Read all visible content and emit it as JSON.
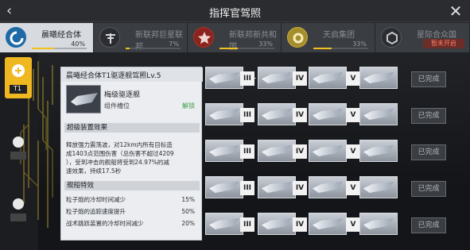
{
  "header": {
    "title": "指挥官驾照",
    "back_icon": "back-arrow-icon",
    "close_icon": "close-x-icon"
  },
  "tabs": [
    {
      "name": "晨曦经合体",
      "progress_text": "40%",
      "progress": 0.4,
      "icon": "dawn-faction-icon",
      "active": true
    },
    {
      "name": "新联邦巨星联邦",
      "progress_text": "7%",
      "progress": 0.07,
      "icon": "cross-faction-icon"
    },
    {
      "name": "新联邦新共和国",
      "progress_text": "33%",
      "progress": 0.33,
      "icon": "star-faction-icon"
    },
    {
      "name": "天启集团",
      "progress_text": "33%",
      "progress": 0.33,
      "icon": "gear-faction-icon"
    },
    {
      "name": "星际合众国",
      "progress_text": "0%",
      "progress": 0.0,
      "icon": "hex-faction-icon",
      "locked_text": "暂未开启"
    }
  ],
  "sidebar": {
    "ranks": [
      {
        "label": "T1",
        "icon": "tier-badge-icon"
      },
      {
        "label": "",
        "icon": "tier-badge-icon"
      },
      {
        "label": "",
        "icon": "tier-badge-icon"
      }
    ]
  },
  "grid": {
    "tiers": [
      "III",
      "IV",
      "V"
    ],
    "rows": [
      {
        "status": "已完成"
      },
      {
        "status": "已完成"
      },
      {
        "status": "已完成"
      },
      {
        "status": "已完成"
      },
      {
        "status": "已完成"
      }
    ]
  },
  "popup": {
    "title": "晨曦经合体T1驱逐舰驾照Lv.5",
    "ship_name": "梅级驱逐舰",
    "slot_label": "组件槽位",
    "slot_status": "解锁",
    "section1": "超级装置效果",
    "desc_line1": "释放强力震荡波，对12km内所有目标造",
    "desc_line2": "成1403点范围伤害（总伤害不超过4209",
    "desc_line3": "），受到冲击的舰船将受到24.97%的减",
    "desc_line4": "速效果，持续17.5秒",
    "section2": "舰船特效",
    "features": [
      {
        "label": "粒子炮的冷却时间减少",
        "value": "15%"
      },
      {
        "label": "粒子炮的追踪速度提升",
        "value": "50%"
      },
      {
        "label": "战术跳跃装置的冷却时间减少",
        "value": "20%"
      }
    ]
  }
}
